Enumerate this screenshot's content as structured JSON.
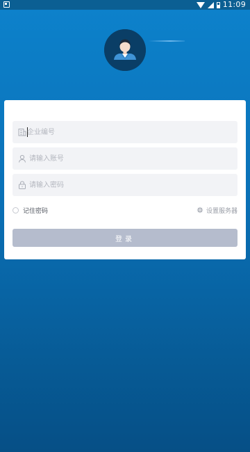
{
  "status_bar": {
    "time": "11:09"
  },
  "icons": {
    "avatar": "user-avatar-icon",
    "company": "building-icon",
    "account": "user-icon",
    "password": "lock-icon",
    "settings": "gear-icon"
  },
  "colors": {
    "background_top": "#0d82cc",
    "background_bottom": "#064f86",
    "button": "#b5bccd",
    "field": "#f2f3f6"
  },
  "form": {
    "company": {
      "placeholder": "企业编号",
      "value": ""
    },
    "account": {
      "placeholder": "请输入账号",
      "value": ""
    },
    "password": {
      "placeholder": "请输入密码",
      "value": ""
    },
    "remember_label": "记住密码",
    "remember_checked": false,
    "server_settings_label": "设置服务器",
    "login_label": "登录"
  }
}
